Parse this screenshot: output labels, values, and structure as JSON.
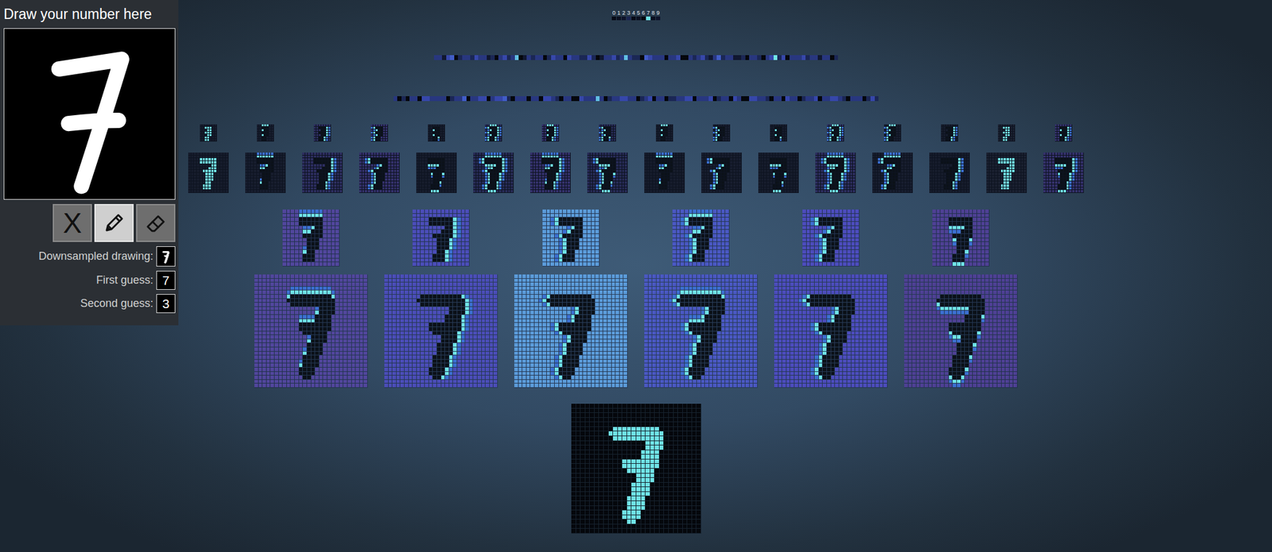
{
  "panel": {
    "title": "Draw your number here",
    "tools": [
      {
        "kind": "clear",
        "label": "X",
        "selected": false
      },
      {
        "kind": "pencil",
        "selected": true
      },
      {
        "kind": "eraser",
        "selected": false
      }
    ],
    "fields": [
      {
        "kind": "image",
        "label": "Downsampled drawing:"
      },
      {
        "kind": "text",
        "label": "First guess:",
        "value": "7"
      },
      {
        "kind": "text",
        "label": "Second guess:",
        "value": "3"
      }
    ]
  },
  "output": {
    "digits": [
      {
        "label": "0",
        "level": 0.05,
        "selected": false
      },
      {
        "label": "1",
        "level": 0.1,
        "selected": false
      },
      {
        "label": "2",
        "level": 0.15,
        "selected": false
      },
      {
        "label": "3",
        "level": 0.35,
        "selected": false
      },
      {
        "label": "4",
        "level": 0.05,
        "selected": false
      },
      {
        "label": "5",
        "level": 0.1,
        "selected": false
      },
      {
        "label": "6",
        "level": 0.02,
        "selected": false
      },
      {
        "label": "7",
        "level": 1,
        "selected": true
      },
      {
        "label": "8",
        "level": 0.1,
        "selected": false
      },
      {
        "label": "9",
        "level": 0.15,
        "selected": false
      }
    ]
  },
  "dense": [
    {
      "levels": "3314502332433120342380132330243304332242013342383220543330334003234213523311203320349240333423313302"
    },
    {
      "levels": "302033044333302335033440344520333033044320330043338302334433023403302233440333402330430044332033043302334033443203330242"
    }
  ],
  "conv2": {
    "maps": [
      {
        "edge": "fill",
        "color": "#161c2c"
      },
      {
        "edge": "top",
        "color": "#171d2e"
      },
      {
        "edge": "right",
        "color": "#2c2d5e"
      },
      {
        "edge": "left",
        "color": "#33306a"
      },
      {
        "edge": "bottom",
        "color": "#161c2c"
      },
      {
        "edge": "outline",
        "color": "#262a55"
      },
      {
        "edge": "top-right",
        "color": "#33306a"
      },
      {
        "edge": "bottom-left",
        "color": "#262a55"
      },
      {
        "edge": "top",
        "color": "#161c2c"
      },
      {
        "edge": "left",
        "color": "#171d2e"
      },
      {
        "edge": "bottom",
        "color": "#161c2c"
      },
      {
        "edge": "outline",
        "color": "#2c2d5e"
      },
      {
        "edge": "top-left",
        "color": "#171d2e"
      },
      {
        "edge": "right",
        "color": "#161c2c"
      },
      {
        "edge": "fill",
        "color": "#1a2030"
      },
      {
        "edge": "bottom-right",
        "color": "#33306a"
      }
    ]
  },
  "conv1": {
    "maps": [
      {
        "edge": "top",
        "color": "#51469c"
      },
      {
        "edge": "right",
        "color": "#4b4db8"
      },
      {
        "edge": "left",
        "color": "#5b9bd9"
      },
      {
        "edge": "top-left",
        "color": "#4a58c2"
      },
      {
        "edge": "left",
        "color": "#4c4cbc"
      },
      {
        "edge": "bottom",
        "color": "#4e4094"
      }
    ]
  },
  "input": {
    "rows": [
      "0000000000000000000000000000",
      "0000000000000000000000000000",
      "0000000000000000000000000000",
      "0000000000000000000000000000",
      "0000000000000000000000000000",
      "0000000009999999999000000000",
      "0000000099999999999900000000",
      "0000000009999999999900000000",
      "0000000000000000999900000000",
      "0000000000000000999900000000",
      "0000000000000009999000000000",
      "0000000000000009999000000000",
      "0000000000099999999000000000",
      "0000000000099999999000000000",
      "0000000000009999990000000000",
      "0000000000000099990000000000",
      "0000000000000099990000000000",
      "0000000000000999900000000000",
      "0000000000000999900000000000",
      "0000000000000999900000000000",
      "0000000000009999000000000000",
      "0000000000009999000000000000",
      "0000000000009999000000000000",
      "0000000000099990000000000000",
      "0000000000099990000000000000",
      "0000000000009900000000000000",
      "0000000000000000000000000000",
      "0000000000000000000000000000"
    ]
  }
}
